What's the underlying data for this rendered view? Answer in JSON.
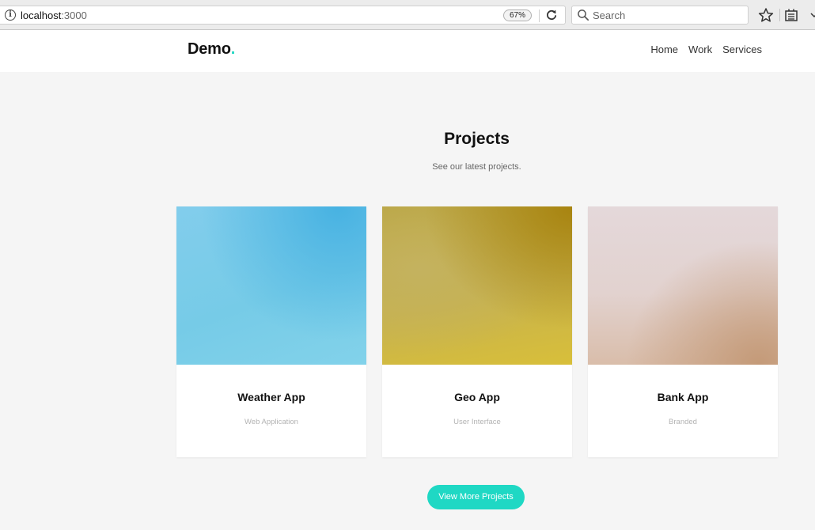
{
  "browser": {
    "url_host": "localhost",
    "url_port": ":3000",
    "zoom": "67%",
    "search_placeholder": "Search"
  },
  "header": {
    "logo_text": "Demo",
    "logo_dot": ".",
    "nav": [
      {
        "label": "Home"
      },
      {
        "label": "Work"
      },
      {
        "label": "Services"
      }
    ]
  },
  "projects": {
    "title": "Projects",
    "subtitle": "See our latest projects.",
    "cards": [
      {
        "title": "Weather App",
        "category": "Web Application"
      },
      {
        "title": "Geo App",
        "category": "User Interface"
      },
      {
        "title": "Bank App",
        "category": "Branded"
      }
    ],
    "cta_label": "View More Projects"
  },
  "colors": {
    "accent": "#1fd8c4",
    "background": "#f5f5f5",
    "card_weather": "#7ccbea",
    "card_geo": "#c4ae44",
    "card_bank": "#dcc6c0"
  }
}
